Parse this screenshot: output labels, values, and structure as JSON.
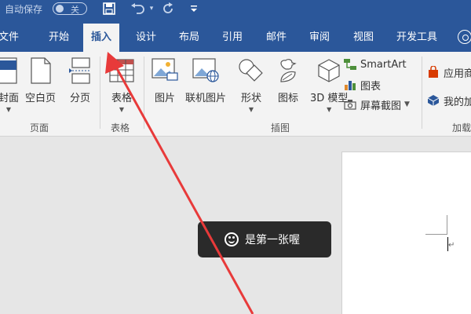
{
  "titlebar": {
    "autosave_label": "自动保存",
    "autosave_state": "关",
    "icons": [
      "save-icon",
      "undo-icon",
      "redo-icon",
      "customize-icon"
    ]
  },
  "tabs": [
    "文件",
    "开始",
    "插入",
    "设计",
    "布局",
    "引用",
    "邮件",
    "审阅",
    "视图",
    "开发工具"
  ],
  "active_tab": "插入",
  "ribbon": {
    "pages": {
      "cover": "封面",
      "blank": "空白页",
      "break": "分页",
      "group": "页面"
    },
    "tables": {
      "table": "表格",
      "group": "表格"
    },
    "illustrations": {
      "picture": "图片",
      "online_picture": "联机图片",
      "shapes": "形状",
      "icons": "图标",
      "model3d": "3D 模型",
      "smartart": "SmartArt",
      "chart": "图表",
      "screenshot": "屏幕截图",
      "group": "插图"
    },
    "addins": {
      "store": "应用商",
      "my_addins": "我的加",
      "group": "加载"
    }
  },
  "toast": {
    "text": "是第一张喔"
  },
  "colors": {
    "accent": "#2b579a",
    "ribbon_bg": "#f3f3f3",
    "annotation_arrow": "#e83a3a"
  }
}
